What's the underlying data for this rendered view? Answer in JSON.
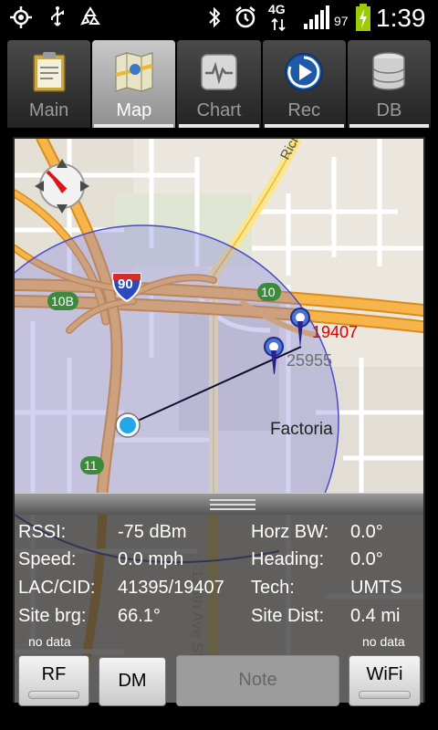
{
  "status_bar": {
    "network_label": "4G",
    "battery_percent": "97",
    "time": "1:39",
    "icons": [
      "gps-icon",
      "usb-icon",
      "recycle-icon",
      "bluetooth-icon",
      "alarm-icon",
      "signal-icon",
      "battery-charging-icon"
    ]
  },
  "tabs": [
    {
      "label": "Main",
      "icon": "clipboard-icon",
      "active": false
    },
    {
      "label": "Map",
      "icon": "map-icon",
      "active": true
    },
    {
      "label": "Chart",
      "icon": "chart-icon",
      "active": false
    },
    {
      "label": "Rec",
      "icon": "record-icon",
      "active": false
    },
    {
      "label": "DB",
      "icon": "database-icon",
      "active": false
    }
  ],
  "map": {
    "labels": {
      "road_richards": "Richar",
      "interstate": "90",
      "exit_10b": "10B",
      "exit_10": "10",
      "exit_11": "11",
      "cell_serving": "19407",
      "cell_neighbor": "25955",
      "place": "Factoria",
      "street": "128th Ave SE"
    },
    "colors": {
      "serving_cell": "#d40000",
      "neighbor_cell": "#6e6e6e",
      "coverage_circle": "#7d7ddc"
    }
  },
  "info": {
    "rssi_label": "RSSI:",
    "rssi_value": "-75 dBm",
    "horz_bw_label": "Horz BW:",
    "horz_bw_value": "0.0°",
    "speed_label": "Speed:",
    "speed_value": "0.0 mph",
    "heading_label": "Heading:",
    "heading_value": "0.0°",
    "lac_cid_label": "LAC/CID:",
    "lac_cid_value": "41395/19407",
    "tech_label": "Tech:",
    "tech_value": "UMTS",
    "site_brg_label": "Site brg:",
    "site_brg_value": "66.1°",
    "site_dist_label": "Site Dist:",
    "site_dist_value": "0.4 mi"
  },
  "buttons": {
    "rf_status": "no data",
    "wifi_status": "no data",
    "rf": "RF",
    "dm": "DM",
    "note": "Note",
    "wifi": "WiFi"
  }
}
